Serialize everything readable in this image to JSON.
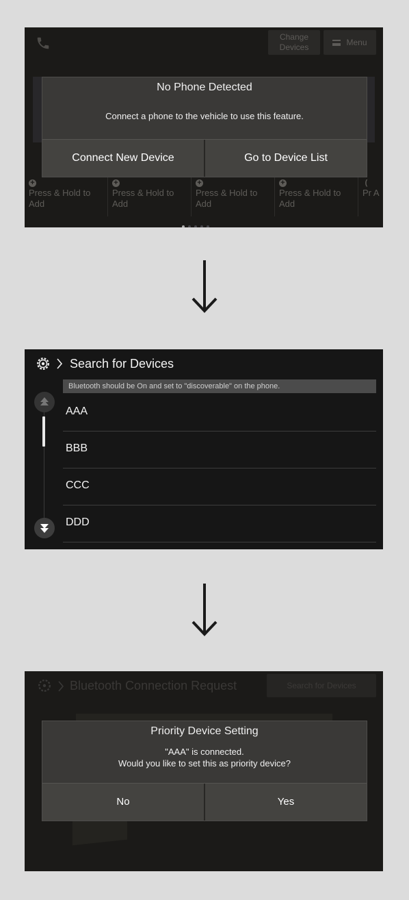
{
  "screen1": {
    "change_devices": "Change\nDevices",
    "menu": "Menu",
    "dialog": {
      "title": "No Phone Detected",
      "message": "Connect a phone to the vehicle to use this feature.",
      "buttons": [
        "Connect New Device",
        "Go to Device List"
      ]
    },
    "favorites": [
      "Press & Hold to Add",
      "Press & Hold to Add",
      "Press & Hold to Add",
      "Press & Hold to Add",
      "Pr A"
    ],
    "page_dots": {
      "count": 5,
      "active": 0
    }
  },
  "screen2": {
    "title": "Search for Devices",
    "hint": "Bluetooth should be On and set to \"discoverable\" on the phone.",
    "devices": [
      "AAA",
      "BBB",
      "CCC",
      "DDD"
    ]
  },
  "screen3": {
    "title": "Bluetooth Connection Request",
    "search_button": "Search for Devices",
    "dialog": {
      "title": "Priority Device Setting",
      "message_line1": "\"AAA\" is connected.",
      "message_line2": "Would you like to set this as priority device?",
      "buttons": [
        "No",
        "Yes"
      ]
    }
  },
  "icons": [
    "phone-icon",
    "menu-icon",
    "plus-icon",
    "arrow-down-icon",
    "gear-icon",
    "chevron-right-icon",
    "scroll-up-icon",
    "scroll-down-icon"
  ],
  "colors": {
    "page_bg": "#dcdcdc",
    "screen_bg": "#1b1a18",
    "dialog_bg": "#3a3937",
    "hint_bg": "#4b4b4b"
  }
}
